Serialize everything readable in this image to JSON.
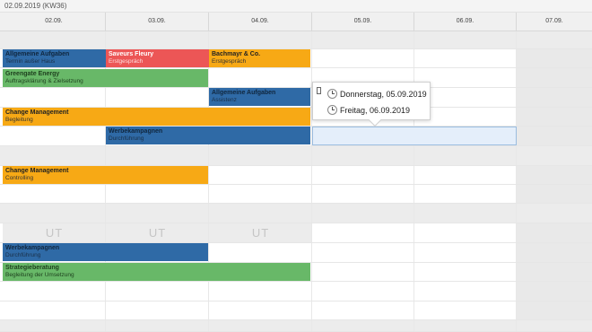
{
  "header": {
    "week_label": "02.09.2019 (KW36)"
  },
  "days": [
    "02.09.",
    "03.09.",
    "04.09.",
    "05.09.",
    "06.09.",
    "07.09."
  ],
  "absence_label": "UT",
  "events": [
    {
      "title": "Allgemeine Aufgaben",
      "subtitle": "Termin außer Haus",
      "color": "blue"
    },
    {
      "title": "Saveurs Fleury",
      "subtitle": "Erstgespräch",
      "color": "red"
    },
    {
      "title": "Bachmayr & Co.",
      "subtitle": "Erstgespräch",
      "color": "orange"
    },
    {
      "title": "Greengate Energy",
      "subtitle": "Auftragsklärung & Zielsetzung",
      "color": "green"
    },
    {
      "title": "Allgemeine Aufgaben",
      "subtitle": "Assistenz",
      "color": "blue"
    },
    {
      "title": "Change Management",
      "subtitle": "Begleitung",
      "color": "orange"
    },
    {
      "title": "Werbekampagnen",
      "subtitle": "Durchführung",
      "color": "blue"
    },
    {
      "title": "Change Management",
      "subtitle": "Controlling",
      "color": "orange"
    },
    {
      "title": "Werbekampagnen",
      "subtitle": "Durchführung",
      "color": "blue"
    },
    {
      "title": "Strategieberatung",
      "subtitle": "Begleitung der Umsetzung",
      "color": "green"
    }
  ],
  "popup": {
    "options": [
      "Donnerstag, 05.09.2019",
      "Freitag, 06.09.2019"
    ]
  },
  "colors": {
    "blue": "#2f6aa6",
    "red": "#ec5656",
    "orange": "#f7a915",
    "green": "#68b868",
    "selection": "#e4eefa"
  }
}
